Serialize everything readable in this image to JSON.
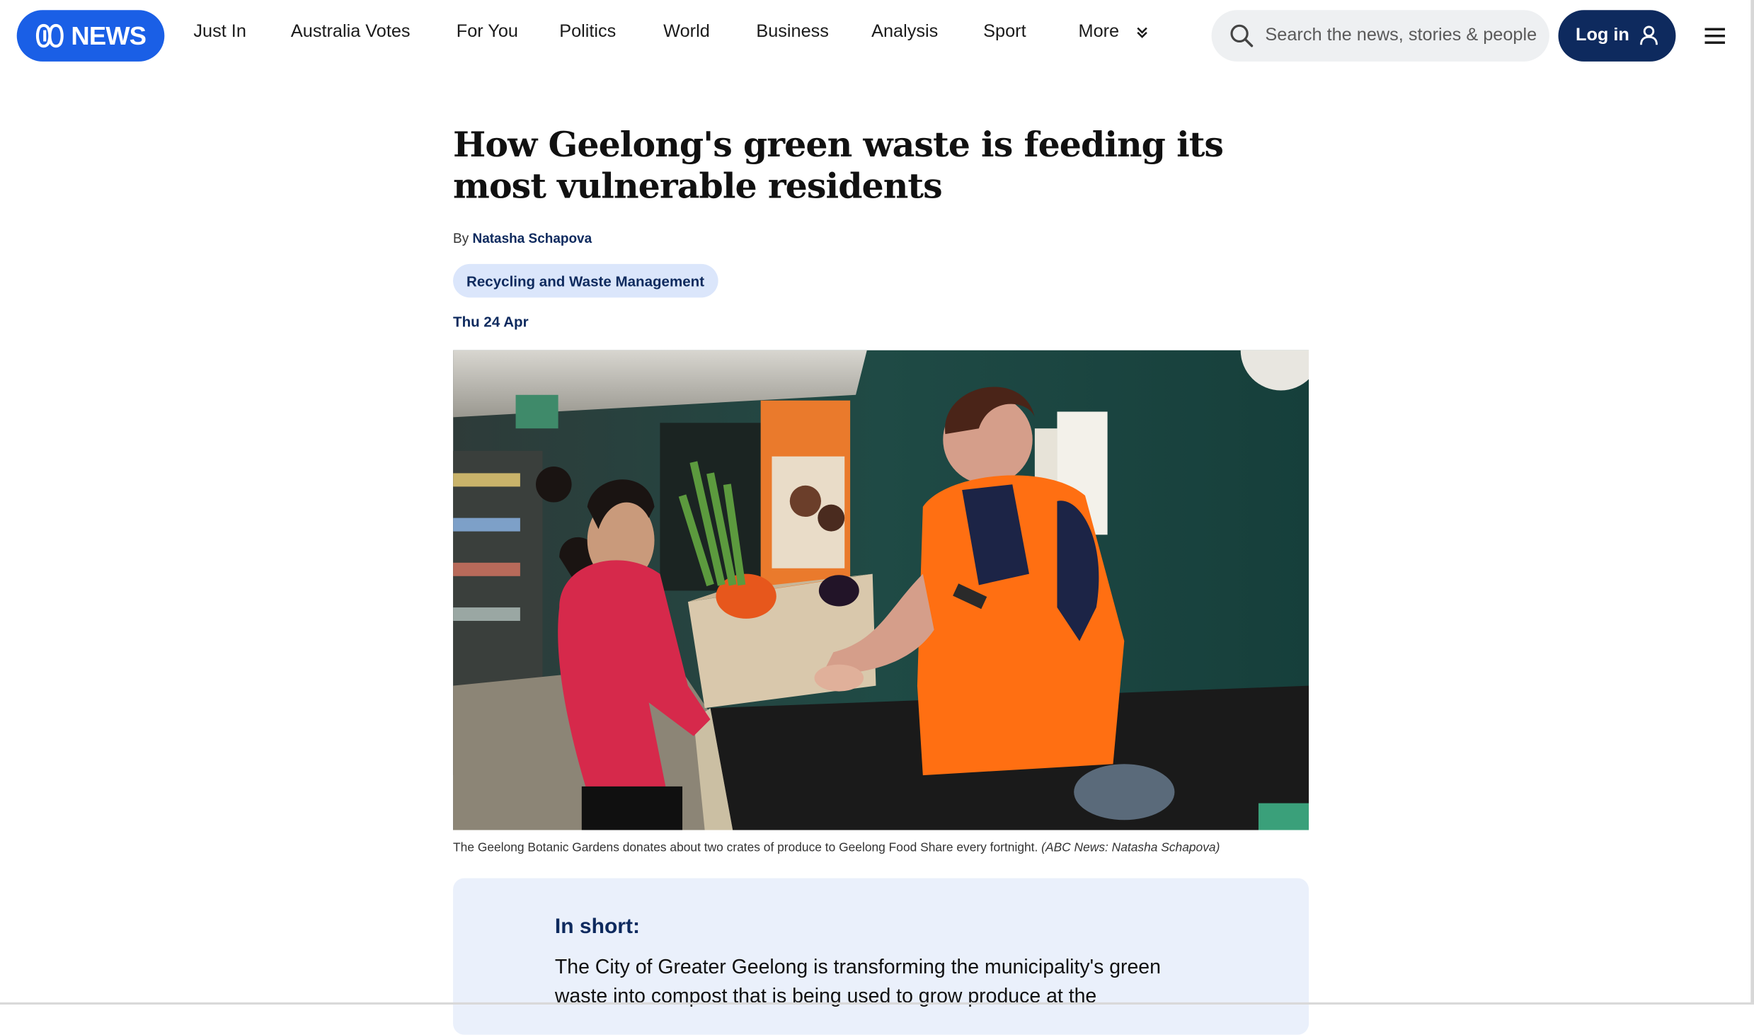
{
  "brand": {
    "logo_text": "NEWS",
    "accent": "#1a5fe6",
    "navy": "#0e2a5e"
  },
  "nav": {
    "items": [
      "Just In",
      "Australia Votes",
      "For You",
      "Politics",
      "World",
      "Business",
      "Analysis",
      "Sport"
    ],
    "more_label": "More"
  },
  "search": {
    "placeholder": "Search the news, stories & people"
  },
  "login": {
    "label": "Log in"
  },
  "article": {
    "headline": "How Geelong's green waste is feeding its most vulnerable residents",
    "by_prefix": "By",
    "author": "Natasha Schapova",
    "tag": "Recycling and Waste Management",
    "date": "Thu 24 Apr",
    "caption": "The Geelong Botanic Gardens donates about two crates of produce to Geelong Food Share every fortnight.",
    "caption_credit": "(ABC News: Natasha Schapova)"
  },
  "in_short": {
    "title": "In short:",
    "text": "The City of Greater Geelong is transforming the municipality's green waste into compost that is being used to grow produce at the"
  },
  "icons": {
    "search": "search-icon",
    "user": "user-icon",
    "menu": "hamburger-menu-icon",
    "more": "chevron-double-down-icon"
  }
}
